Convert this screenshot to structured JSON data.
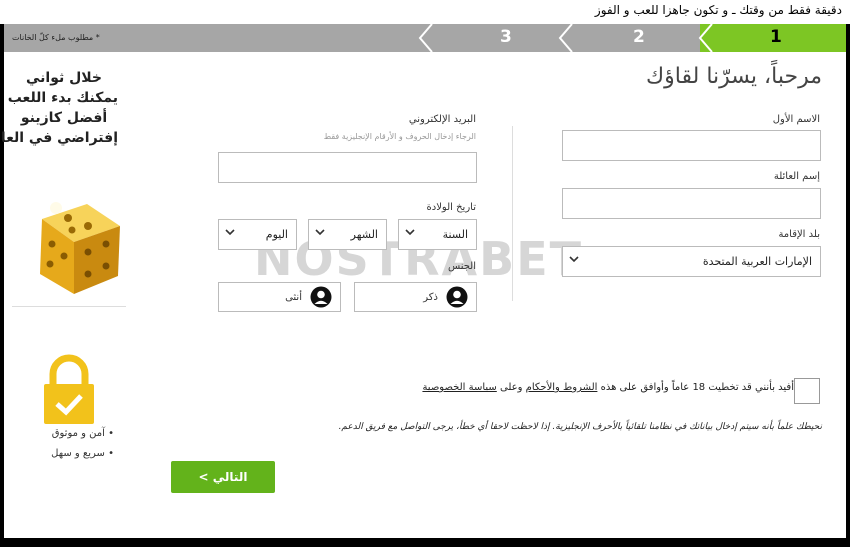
{
  "top_banner": "دقيقة فقط من وقتك ـ و تكون جاهزا للعب و الفوز",
  "steps": {
    "required_note": "* مطلوب ملء كلّ الخانات",
    "items": [
      "1",
      "2",
      "3"
    ],
    "active_index": 0,
    "active_color": "#7dc624"
  },
  "form": {
    "welcome_title": "مرحباً، يسرّنا لقاؤك",
    "first_name_label": "الاسم الأول",
    "first_name_value": "",
    "family_name_label": "إسم العائلة",
    "family_name_value": "",
    "country_label": "بلد الإقامة",
    "country_value": "الإمارات العربية المتحدة",
    "email_label": "البريد الإلكتروني",
    "email_hint": "الرجاء إدخال الحروف و الأرقام الإنجليزية فقط",
    "email_value": "",
    "dob_label": "تاريخ الولادة",
    "dob_year": "السنة",
    "dob_month": "الشهر",
    "dob_day": "اليوم",
    "gender_label": "الجنس",
    "gender_male": "ذكر",
    "gender_female": "أنثى"
  },
  "sidebar": {
    "promo_lines": [
      "خلال ثواني",
      "يمكنك بدء اللعب",
      "أفضل كازينو",
      "إفتراضي في العالم"
    ],
    "features": [
      "• آمن و موثوق",
      "• سريع و سهل"
    ]
  },
  "watermark": "NOSTRABET",
  "terms": {
    "text_1": "أفيد بأنني قد تخطيت 18 عاماً وأوافق على هذه",
    "link_terms": "الشروط والأحكام",
    "text_2": "وعلى",
    "link_privacy": "سياسة الخصوصية"
  },
  "notice": "نحيطك علماً بأنه سيتم إدخال بياناتك في نظامنا تلقائياً بالأحرف الإنجليزية. إذا لاحظت لاحقا أي خطأ، يرجى التواصل مع فريق الدعم.",
  "next_button": "التالي >"
}
